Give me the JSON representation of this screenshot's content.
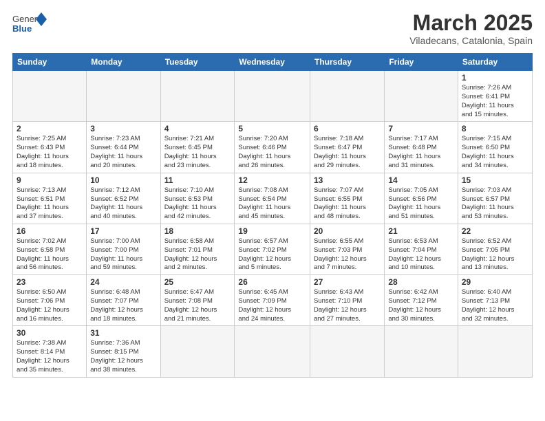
{
  "header": {
    "logo_general": "General",
    "logo_blue": "Blue",
    "month_year": "March 2025",
    "location": "Viladecans, Catalonia, Spain"
  },
  "weekdays": [
    "Sunday",
    "Monday",
    "Tuesday",
    "Wednesday",
    "Thursday",
    "Friday",
    "Saturday"
  ],
  "weeks": [
    [
      {
        "day": "",
        "info": ""
      },
      {
        "day": "",
        "info": ""
      },
      {
        "day": "",
        "info": ""
      },
      {
        "day": "",
        "info": ""
      },
      {
        "day": "",
        "info": ""
      },
      {
        "day": "",
        "info": ""
      },
      {
        "day": "1",
        "info": "Sunrise: 7:26 AM\nSunset: 6:41 PM\nDaylight: 11 hours\nand 15 minutes."
      }
    ],
    [
      {
        "day": "2",
        "info": "Sunrise: 7:25 AM\nSunset: 6:43 PM\nDaylight: 11 hours\nand 18 minutes."
      },
      {
        "day": "3",
        "info": "Sunrise: 7:23 AM\nSunset: 6:44 PM\nDaylight: 11 hours\nand 20 minutes."
      },
      {
        "day": "4",
        "info": "Sunrise: 7:21 AM\nSunset: 6:45 PM\nDaylight: 11 hours\nand 23 minutes."
      },
      {
        "day": "5",
        "info": "Sunrise: 7:20 AM\nSunset: 6:46 PM\nDaylight: 11 hours\nand 26 minutes."
      },
      {
        "day": "6",
        "info": "Sunrise: 7:18 AM\nSunset: 6:47 PM\nDaylight: 11 hours\nand 29 minutes."
      },
      {
        "day": "7",
        "info": "Sunrise: 7:17 AM\nSunset: 6:48 PM\nDaylight: 11 hours\nand 31 minutes."
      },
      {
        "day": "8",
        "info": "Sunrise: 7:15 AM\nSunset: 6:50 PM\nDaylight: 11 hours\nand 34 minutes."
      }
    ],
    [
      {
        "day": "9",
        "info": "Sunrise: 7:13 AM\nSunset: 6:51 PM\nDaylight: 11 hours\nand 37 minutes."
      },
      {
        "day": "10",
        "info": "Sunrise: 7:12 AM\nSunset: 6:52 PM\nDaylight: 11 hours\nand 40 minutes."
      },
      {
        "day": "11",
        "info": "Sunrise: 7:10 AM\nSunset: 6:53 PM\nDaylight: 11 hours\nand 42 minutes."
      },
      {
        "day": "12",
        "info": "Sunrise: 7:08 AM\nSunset: 6:54 PM\nDaylight: 11 hours\nand 45 minutes."
      },
      {
        "day": "13",
        "info": "Sunrise: 7:07 AM\nSunset: 6:55 PM\nDaylight: 11 hours\nand 48 minutes."
      },
      {
        "day": "14",
        "info": "Sunrise: 7:05 AM\nSunset: 6:56 PM\nDaylight: 11 hours\nand 51 minutes."
      },
      {
        "day": "15",
        "info": "Sunrise: 7:03 AM\nSunset: 6:57 PM\nDaylight: 11 hours\nand 53 minutes."
      }
    ],
    [
      {
        "day": "16",
        "info": "Sunrise: 7:02 AM\nSunset: 6:58 PM\nDaylight: 11 hours\nand 56 minutes."
      },
      {
        "day": "17",
        "info": "Sunrise: 7:00 AM\nSunset: 7:00 PM\nDaylight: 11 hours\nand 59 minutes."
      },
      {
        "day": "18",
        "info": "Sunrise: 6:58 AM\nSunset: 7:01 PM\nDaylight: 12 hours\nand 2 minutes."
      },
      {
        "day": "19",
        "info": "Sunrise: 6:57 AM\nSunset: 7:02 PM\nDaylight: 12 hours\nand 5 minutes."
      },
      {
        "day": "20",
        "info": "Sunrise: 6:55 AM\nSunset: 7:03 PM\nDaylight: 12 hours\nand 7 minutes."
      },
      {
        "day": "21",
        "info": "Sunrise: 6:53 AM\nSunset: 7:04 PM\nDaylight: 12 hours\nand 10 minutes."
      },
      {
        "day": "22",
        "info": "Sunrise: 6:52 AM\nSunset: 7:05 PM\nDaylight: 12 hours\nand 13 minutes."
      }
    ],
    [
      {
        "day": "23",
        "info": "Sunrise: 6:50 AM\nSunset: 7:06 PM\nDaylight: 12 hours\nand 16 minutes."
      },
      {
        "day": "24",
        "info": "Sunrise: 6:48 AM\nSunset: 7:07 PM\nDaylight: 12 hours\nand 18 minutes."
      },
      {
        "day": "25",
        "info": "Sunrise: 6:47 AM\nSunset: 7:08 PM\nDaylight: 12 hours\nand 21 minutes."
      },
      {
        "day": "26",
        "info": "Sunrise: 6:45 AM\nSunset: 7:09 PM\nDaylight: 12 hours\nand 24 minutes."
      },
      {
        "day": "27",
        "info": "Sunrise: 6:43 AM\nSunset: 7:10 PM\nDaylight: 12 hours\nand 27 minutes."
      },
      {
        "day": "28",
        "info": "Sunrise: 6:42 AM\nSunset: 7:12 PM\nDaylight: 12 hours\nand 30 minutes."
      },
      {
        "day": "29",
        "info": "Sunrise: 6:40 AM\nSunset: 7:13 PM\nDaylight: 12 hours\nand 32 minutes."
      }
    ],
    [
      {
        "day": "30",
        "info": "Sunrise: 7:38 AM\nSunset: 8:14 PM\nDaylight: 12 hours\nand 35 minutes."
      },
      {
        "day": "31",
        "info": "Sunrise: 7:36 AM\nSunset: 8:15 PM\nDaylight: 12 hours\nand 38 minutes."
      },
      {
        "day": "",
        "info": ""
      },
      {
        "day": "",
        "info": ""
      },
      {
        "day": "",
        "info": ""
      },
      {
        "day": "",
        "info": ""
      },
      {
        "day": "",
        "info": ""
      }
    ]
  ]
}
